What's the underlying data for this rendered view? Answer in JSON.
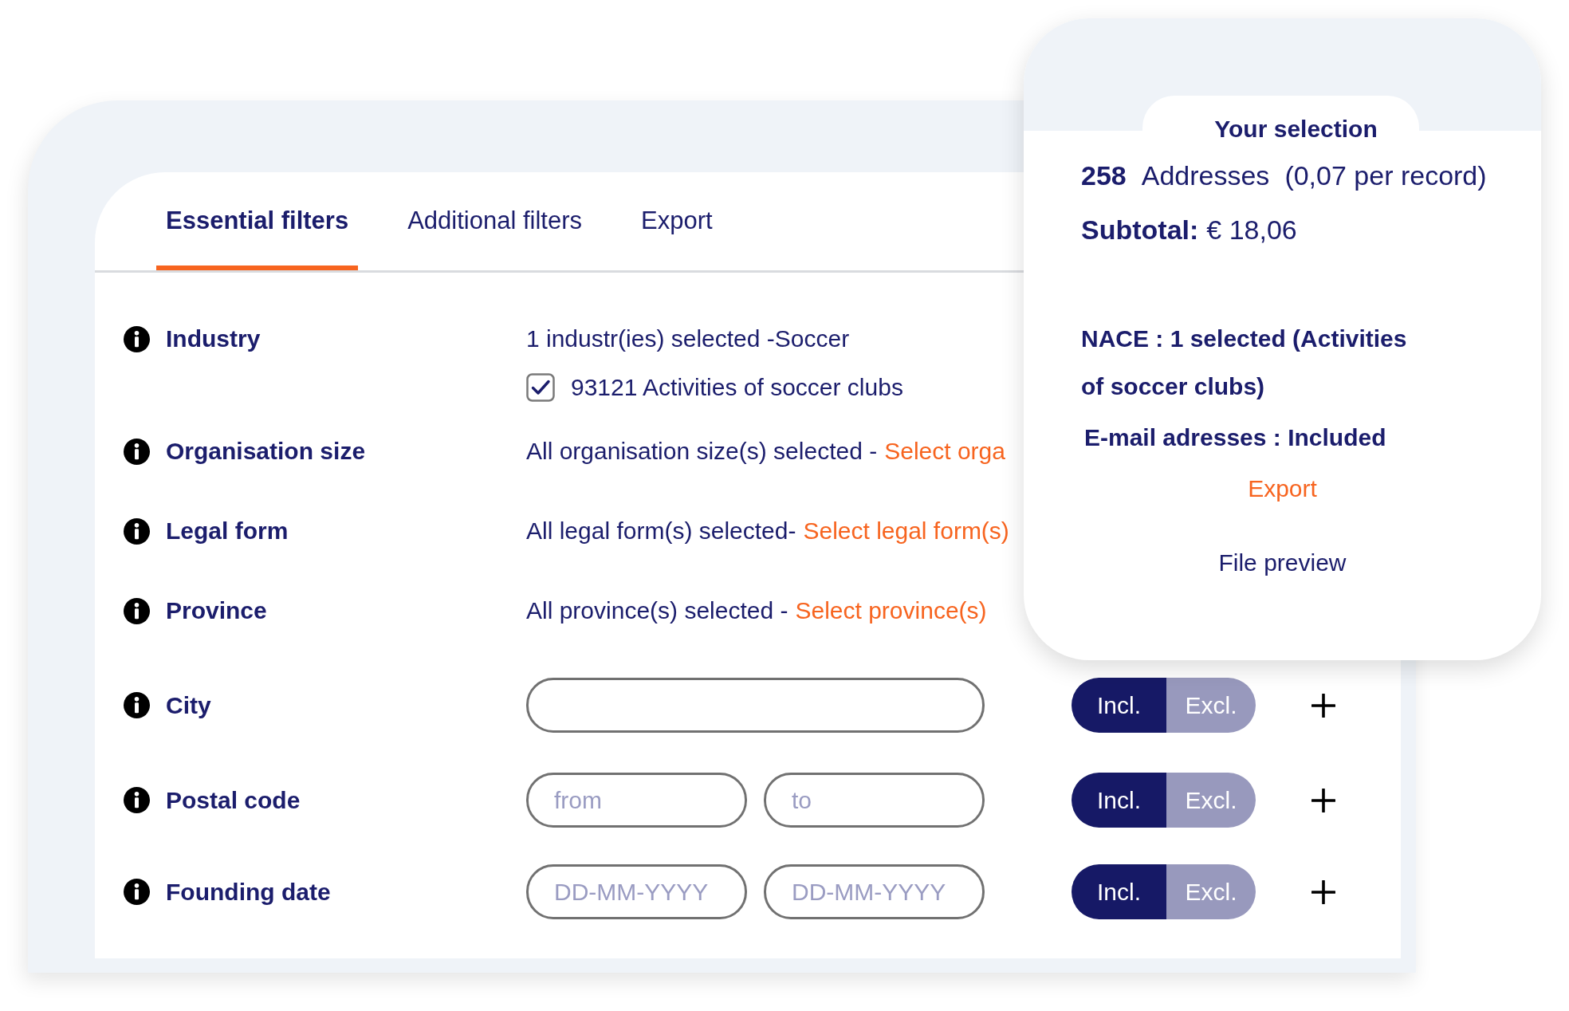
{
  "tabs": [
    {
      "label": "Essential filters",
      "selected": true
    },
    {
      "label": "Additional filters",
      "selected": false
    },
    {
      "label": "Export",
      "selected": false
    }
  ],
  "filters": [
    {
      "kind": "summary",
      "label": "Industry",
      "summary": "1 industr(ies) selected -Soccer",
      "options": [
        {
          "label": "93121 Activities of soccer clubs",
          "checked": true
        }
      ]
    },
    {
      "kind": "summary",
      "label": "Organisation size",
      "summary": "All organisation size(s) selected -",
      "link": "Select orga"
    },
    {
      "kind": "summary",
      "label": "Legal form",
      "summary": "All legal form(s) selected-",
      "link": "Select legal form(s)"
    },
    {
      "kind": "summary",
      "label": "Province",
      "summary": "All province(s) selected -",
      "link": "Select province(s)"
    },
    {
      "kind": "text",
      "label": "City",
      "toggle": [
        {
          "label": "Incl.",
          "selected": true
        },
        {
          "label": "Excl.",
          "selected": false
        }
      ]
    },
    {
      "kind": "range",
      "label": "Postal code",
      "fields": [
        {
          "placeholder": "from"
        },
        {
          "placeholder": "to"
        }
      ],
      "toggle": [
        {
          "label": "Incl.",
          "selected": true
        },
        {
          "label": "Excl.",
          "selected": false
        }
      ]
    },
    {
      "kind": "range",
      "label": "Founding date",
      "fields": [
        {
          "placeholder": "DD-MM-YYYY"
        },
        {
          "placeholder": "DD-MM-YYYY"
        }
      ],
      "toggle": [
        {
          "label": "Incl.",
          "selected": true
        },
        {
          "label": "Excl.",
          "selected": false
        }
      ]
    }
  ],
  "selection": {
    "title": "Your selection",
    "count": "258",
    "count_label": "Addresses",
    "price_note": "(0,07 per record)",
    "subtotal_label": "Subtotal:",
    "subtotal": "€ 18,06",
    "criteria": [
      "NACE : 1 selected (Activities of soccer clubs)",
      "E-mail adresses : Included"
    ],
    "export": "Export",
    "preview": "File preview"
  }
}
